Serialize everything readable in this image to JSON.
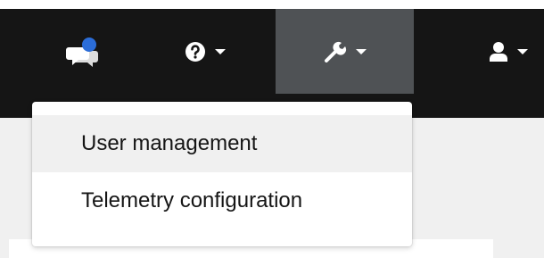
{
  "navbar": {
    "items": [
      {
        "name": "notifications",
        "icon": "chat-bubbles-icon",
        "badge_color": "#2b6dd8"
      },
      {
        "name": "help",
        "icon": "question-circle-icon"
      },
      {
        "name": "admin-tools",
        "icon": "wrench-icon",
        "active": true
      },
      {
        "name": "user",
        "icon": "user-icon"
      }
    ],
    "background": "#151515",
    "active_background": "#4f5255"
  },
  "dropdown": {
    "items": [
      {
        "label": "User management"
      },
      {
        "label": "Telemetry configuration"
      }
    ]
  }
}
